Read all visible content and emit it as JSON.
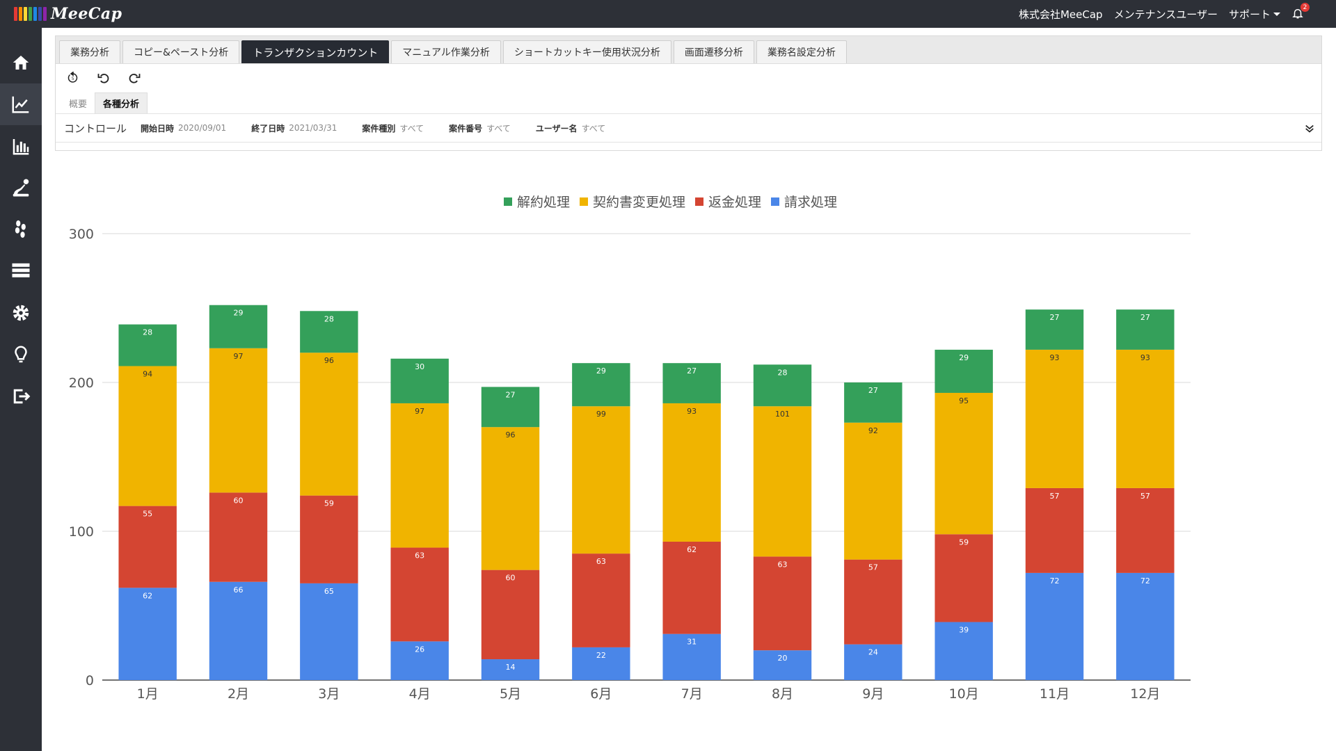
{
  "app": {
    "logo_text": "MeeCap",
    "logo_colors": [
      "#e53935",
      "#fb8c00",
      "#fdd835",
      "#43a047",
      "#1e88e5",
      "#3949ab",
      "#8e24aa"
    ]
  },
  "header": {
    "company": "株式会社MeeCap",
    "user": "メンテナンスユーザー",
    "support_label": "サポート",
    "notification_count": "2"
  },
  "sidebar": {
    "items": [
      {
        "icon": "home-icon"
      },
      {
        "icon": "line-chart-icon",
        "active": true
      },
      {
        "icon": "bar-chart-icon"
      },
      {
        "icon": "flow-icon"
      },
      {
        "icon": "footsteps-icon"
      },
      {
        "icon": "list-icon"
      },
      {
        "icon": "gear-icon"
      },
      {
        "icon": "lightbulb-icon"
      },
      {
        "icon": "logout-icon"
      }
    ]
  },
  "tabs": [
    {
      "label": "業務分析"
    },
    {
      "label": "コピー&ペースト分析"
    },
    {
      "label": "トランザクションカウント",
      "active": true
    },
    {
      "label": "マニュアル作業分析"
    },
    {
      "label": "ショートカットキー使用状況分析"
    },
    {
      "label": "画面遷移分析"
    },
    {
      "label": "業務名設定分析"
    }
  ],
  "subtabs": [
    {
      "label": "概要"
    },
    {
      "label": "各種分析",
      "active": true
    }
  ],
  "control": {
    "title": "コントロール",
    "filters": [
      {
        "label": "開始日時",
        "value": "2020/09/01"
      },
      {
        "label": "終了日時",
        "value": "2021/03/31"
      },
      {
        "label": "案件種別",
        "value": "すべて"
      },
      {
        "label": "案件番号",
        "value": "すべて"
      },
      {
        "label": "ユーザー名",
        "value": "すべて"
      }
    ]
  },
  "chart_data": {
    "type": "bar",
    "stacked": true,
    "categories": [
      "1月",
      "2月",
      "3月",
      "4月",
      "5月",
      "6月",
      "7月",
      "8月",
      "9月",
      "10月",
      "11月",
      "12月"
    ],
    "ylim": [
      0,
      300
    ],
    "yticks": [
      0,
      100,
      200,
      300
    ],
    "grid": true,
    "legend_position": "top",
    "series": [
      {
        "name": "請求処理",
        "color": "#4a86e8",
        "values": [
          62,
          66,
          65,
          26,
          14,
          22,
          31,
          20,
          24,
          39,
          72,
          72
        ]
      },
      {
        "name": "返金処理",
        "color": "#d44532",
        "values": [
          55,
          60,
          59,
          63,
          60,
          63,
          62,
          63,
          57,
          59,
          57,
          57
        ]
      },
      {
        "name": "契約書変更処理",
        "color": "#f0b400",
        "values": [
          94,
          97,
          96,
          97,
          96,
          99,
          93,
          101,
          92,
          95,
          93,
          93
        ]
      },
      {
        "name": "解約処理",
        "color": "#34a05a",
        "values": [
          28,
          29,
          28,
          30,
          27,
          29,
          27,
          28,
          27,
          29,
          27,
          27
        ]
      }
    ]
  }
}
